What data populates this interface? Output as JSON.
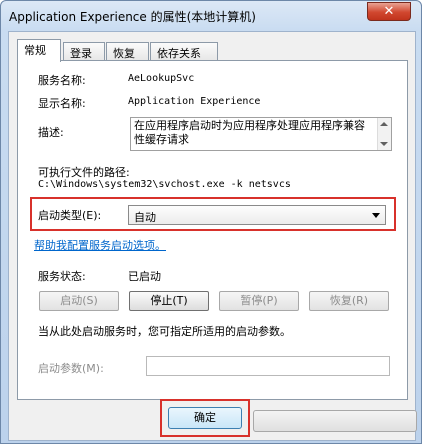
{
  "window": {
    "title": "Application Experience 的属性(本地计算机)",
    "close_symbol": "✕"
  },
  "tabs": [
    {
      "label": "常规"
    },
    {
      "label": "登录"
    },
    {
      "label": "恢复"
    },
    {
      "label": "依存关系"
    }
  ],
  "general": {
    "service_name_label": "服务名称:",
    "service_name_value": "AeLookupSvc",
    "display_name_label": "显示名称:",
    "display_name_value": "Application Experience",
    "description_label": "描述:",
    "description_value": "在应用程序启动时为应用程序处理应用程序兼容性缓存请求",
    "exe_path_label": "可执行文件的路径:",
    "exe_path_value": "C:\\Windows\\system32\\svchost.exe -k netsvcs",
    "startup_type_label": "启动类型(E):",
    "startup_type_value": "自动",
    "help_link": "帮助我配置服务启动选项。",
    "status_label": "服务状态:",
    "status_value": "已启动",
    "buttons": {
      "start": "启动(S)",
      "stop": "停止(T)",
      "pause": "暂停(P)",
      "resume": "恢复(R)"
    },
    "start_params_hint": "当从此处启动服务时，您可指定所适用的启动参数。",
    "start_params_label": "启动参数(M):",
    "start_params_value": ""
  },
  "footer": {
    "ok_label": "确定"
  },
  "colors": {
    "highlight": "#d8312b",
    "link": "#0066cc",
    "close": "#c0331c"
  }
}
